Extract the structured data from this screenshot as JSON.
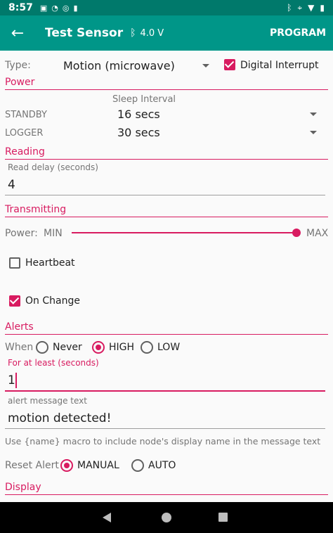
{
  "status": {
    "time": "8:57",
    "left_icons": [
      "sim-icon",
      "clock-icon",
      "sync-icon",
      "sd-icon"
    ],
    "right_icons": [
      "bluetooth-icon",
      "location-icon",
      "wifi-icon",
      "battery-icon"
    ]
  },
  "app_bar": {
    "title": "Test Sensor",
    "voltage": "4.0 V",
    "program": "PROGRAM"
  },
  "type_row": {
    "label": "Type:",
    "value": "Motion (microwave)",
    "interrupt_label": "Digital Interrupt",
    "interrupt_checked": true
  },
  "power": {
    "section": "Power",
    "sleep_header": "Sleep Interval",
    "standby_label": "STANDBY",
    "standby_value": "16 secs",
    "logger_label": "LOGGER",
    "logger_value": "30 secs"
  },
  "reading": {
    "section": "Reading",
    "delay_label": "Read delay (seconds)",
    "delay_value": "4"
  },
  "transmitting": {
    "section": "Transmitting",
    "power_label": "Power:",
    "min": "MIN",
    "max": "MAX",
    "power_level": 1.0,
    "heartbeat_label": "Heartbeat",
    "heartbeat_checked": false,
    "onchange_label": "On Change",
    "onchange_checked": true
  },
  "alerts": {
    "section": "Alerts",
    "when_label": "When",
    "when_options": [
      "Never",
      "HIGH",
      "LOW"
    ],
    "when_selected": "HIGH",
    "atleast_label": "For at least (seconds)",
    "atleast_value": "1",
    "message_label": "alert message text",
    "message_value": "motion detected!",
    "hint": "Use {name} macro to include node's display name in the message text",
    "reset_label": "Reset Alert",
    "reset_options": [
      "MANUAL",
      "AUTO"
    ],
    "reset_selected": "MANUAL"
  },
  "display": {
    "section": "Display"
  },
  "colors": {
    "primary": "#009688",
    "primary_dark": "#00796b",
    "accent": "#d81b60"
  }
}
